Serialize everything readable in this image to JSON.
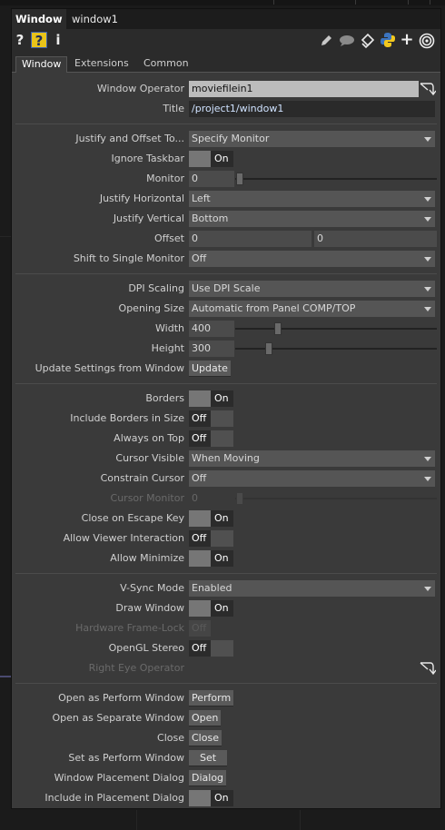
{
  "header": {
    "type": "Window",
    "name": "window1"
  },
  "icons": [
    "help-icon",
    "python-help-icon",
    "info-icon",
    "edit-icon",
    "comment-icon",
    "clone-icon",
    "python-icon",
    "add-icon",
    "viewer-icon"
  ],
  "iconbar": {
    "help": "?",
    "python_help": "?",
    "info": "i",
    "add": "+"
  },
  "tabs": [
    {
      "label": "Window"
    },
    {
      "label": "Extensions"
    },
    {
      "label": "Common"
    }
  ],
  "params": {
    "window_operator": {
      "label": "Window Operator",
      "value": "moviefilein1"
    },
    "title": {
      "label": "Title",
      "value": "/project1/window1"
    },
    "justify_offset_to": {
      "label": "Justify and Offset To...",
      "value": "Specify Monitor"
    },
    "ignore_taskbar": {
      "label": "Ignore Taskbar",
      "value": "On"
    },
    "monitor": {
      "label": "Monitor",
      "value": "0"
    },
    "justify_horizontal": {
      "label": "Justify Horizontal",
      "value": "Left"
    },
    "justify_vertical": {
      "label": "Justify Vertical",
      "value": "Bottom"
    },
    "offset": {
      "label": "Offset",
      "x": "0",
      "y": "0"
    },
    "shift_single_monitor": {
      "label": "Shift to Single Monitor",
      "value": "Off"
    },
    "dpi_scaling": {
      "label": "DPI Scaling",
      "value": "Use DPI Scale"
    },
    "opening_size": {
      "label": "Opening Size",
      "value": "Automatic from Panel COMP/TOP"
    },
    "width": {
      "label": "Width",
      "value": "400"
    },
    "height": {
      "label": "Height",
      "value": "300"
    },
    "update_settings": {
      "label": "Update Settings from Window",
      "button": "Update"
    },
    "borders": {
      "label": "Borders",
      "value": "On"
    },
    "include_borders": {
      "label": "Include Borders in Size",
      "value": "Off"
    },
    "always_on_top": {
      "label": "Always on Top",
      "value": "Off"
    },
    "cursor_visible": {
      "label": "Cursor Visible",
      "value": "When Moving"
    },
    "constrain_cursor": {
      "label": "Constrain Cursor",
      "value": "Off"
    },
    "cursor_monitor": {
      "label": "Cursor Monitor",
      "value": "0"
    },
    "close_on_escape": {
      "label": "Close on Escape Key",
      "value": "On"
    },
    "allow_viewer_interaction": {
      "label": "Allow Viewer Interaction",
      "value": "Off"
    },
    "allow_minimize": {
      "label": "Allow Minimize",
      "value": "On"
    },
    "vsync_mode": {
      "label": "V-Sync Mode",
      "value": "Enabled"
    },
    "draw_window": {
      "label": "Draw Window",
      "value": "On"
    },
    "hardware_framelock": {
      "label": "Hardware Frame-Lock",
      "value": "Off"
    },
    "opengl_stereo": {
      "label": "OpenGL Stereo",
      "value": "Off"
    },
    "right_eye_operator": {
      "label": "Right Eye Operator"
    },
    "open_as_perform": {
      "label": "Open as Perform Window",
      "button": "Perform"
    },
    "open_as_separate": {
      "label": "Open as Separate Window",
      "button": "Open"
    },
    "close": {
      "label": "Close",
      "button": "Close"
    },
    "set_as_perform": {
      "label": "Set as Perform Window",
      "button": "Set"
    },
    "window_placement": {
      "label": "Window Placement Dialog",
      "button": "Dialog"
    },
    "include_in_placement": {
      "label": "Include in Placement Dialog",
      "value": "On"
    }
  }
}
